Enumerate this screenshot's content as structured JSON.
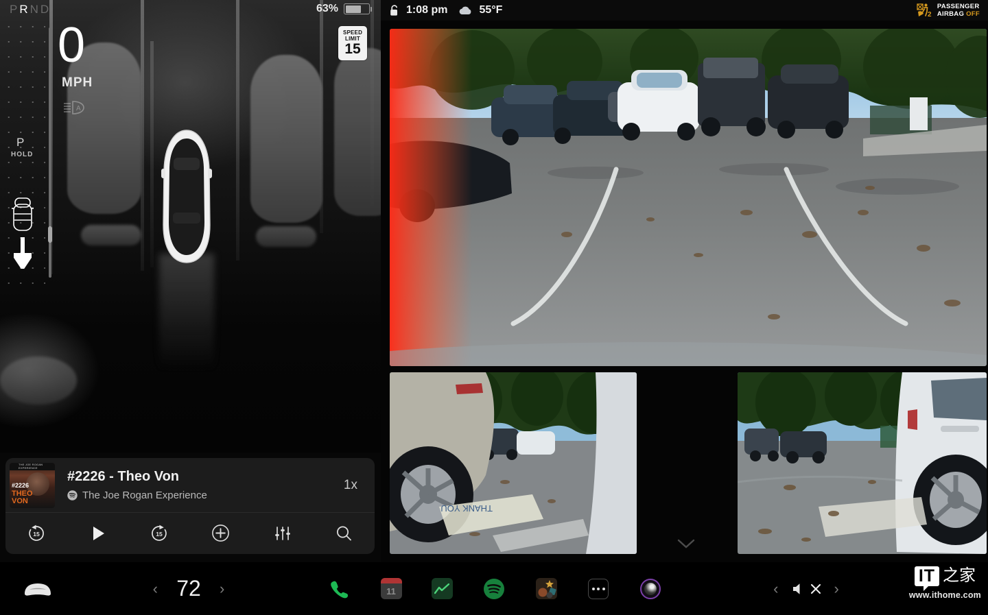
{
  "driving": {
    "gear_letters": [
      "P",
      "R",
      "N",
      "D"
    ],
    "active_gear": "R",
    "battery_percent": "63%",
    "speed_value": "0",
    "speed_unit": "MPH",
    "speed_limit_label_line1": "SPEED",
    "speed_limit_label_line2": "LIMIT",
    "speed_limit_value": "15",
    "hold_gear": "P",
    "hold_label": "HOLD",
    "autolight_letter": "A"
  },
  "topbar": {
    "lock_state": "unlocked",
    "time": "1:08 pm",
    "temperature": "55°F",
    "airbag_line1": "PASSENGER",
    "airbag_line2_prefix": "AIRBAG",
    "airbag_line2_status": "OFF",
    "airbag_seat_count": "2"
  },
  "media": {
    "title": "#2226 - Theo Von",
    "subtitle": "The Joe Rogan Experience",
    "source_icon": "spotify-icon",
    "playback_speed": "1x",
    "art_header": "THE JOE ROGAN EXPERIENCE",
    "art_number": "#2226",
    "art_line1": "THEO",
    "art_line2": "VON",
    "controls": [
      {
        "name": "rewind-15-button",
        "label": "15"
      },
      {
        "name": "play-button",
        "label": ""
      },
      {
        "name": "forward-15-button",
        "label": "15"
      },
      {
        "name": "add-to-library-button",
        "label": ""
      },
      {
        "name": "equalizer-button",
        "label": ""
      },
      {
        "name": "search-button",
        "label": ""
      }
    ]
  },
  "cameras": {
    "main_view": "rear-camera",
    "bottom_left_view": "left-repeater-camera",
    "bottom_right_view": "right-repeater-camera",
    "collapse_indicator": "chevron-down-icon"
  },
  "dock": {
    "car_icon": "car-icon",
    "temp_prev": "‹",
    "temp_value": "72",
    "temp_next": "›",
    "apps": [
      {
        "name": "phone-app-icon",
        "label": ""
      },
      {
        "name": "calendar-app-icon",
        "label": "11"
      },
      {
        "name": "stocks-app-icon",
        "label": ""
      },
      {
        "name": "spotify-app-icon",
        "label": ""
      },
      {
        "name": "toybox-app-icon",
        "label": ""
      },
      {
        "name": "more-apps-icon",
        "label": ""
      },
      {
        "name": "camera-app-icon",
        "label": ""
      }
    ],
    "volume_prev": "‹",
    "volume_icon": "volume-muted-icon",
    "volume_next": "›"
  },
  "watermark": {
    "logo_text": "IT",
    "logo_cn": "之家",
    "url": "www.ithome.com"
  }
}
